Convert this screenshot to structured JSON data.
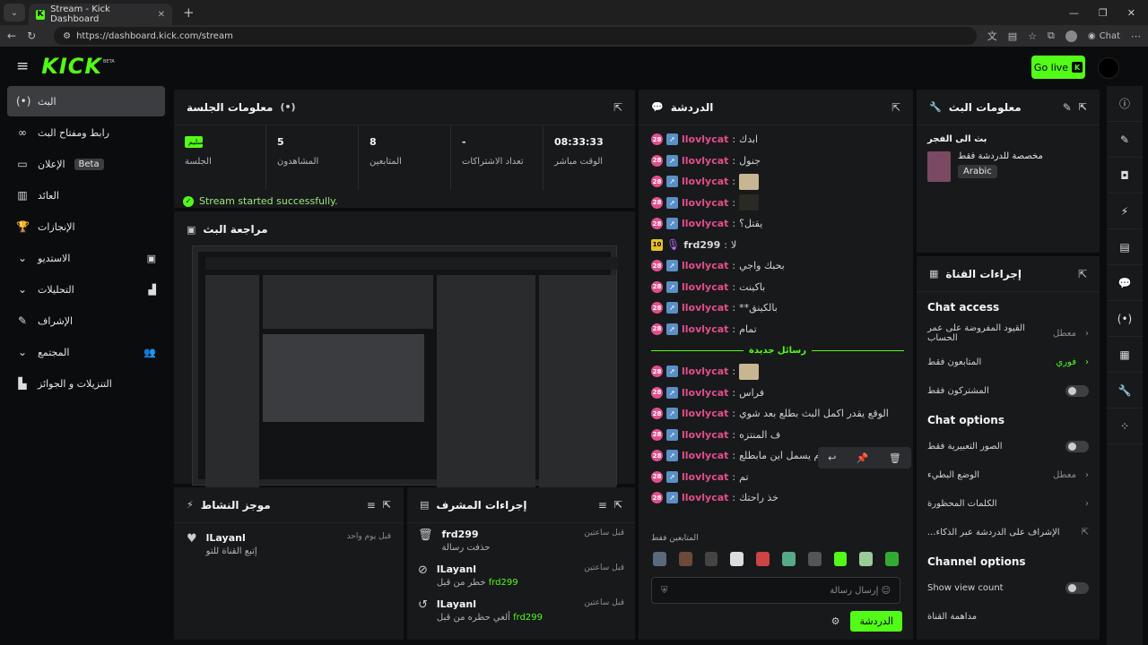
{
  "browser": {
    "tab_title": "Stream - Kick Dashboard",
    "url": "https://dashboard.kick.com/stream",
    "chat_label": "Chat"
  },
  "header": {
    "logo": "KICK",
    "beta": "BETA",
    "go_live": "Go live"
  },
  "sidebar": {
    "items": [
      {
        "label": "البث",
        "icon": "broadcast-icon"
      },
      {
        "label": "رابط ومفتاح البث",
        "icon": "link-icon"
      },
      {
        "label": "الإعلان",
        "badge": "Beta",
        "icon": "ads-icon"
      },
      {
        "label": "العائد",
        "icon": "revenue-icon"
      },
      {
        "label": "الإنجازات",
        "icon": "trophy-icon"
      },
      {
        "label": "الاستديو",
        "icon": "studio-icon"
      },
      {
        "label": "التحليلات",
        "icon": "analytics-icon"
      },
      {
        "label": "الإشراف",
        "icon": "moderation-icon"
      },
      {
        "label": "المجتمع",
        "icon": "community-icon"
      },
      {
        "label": "التنزيلات و الجوائز",
        "icon": "drops-icon"
      }
    ]
  },
  "session": {
    "title": "معلومات الجلسة",
    "health": "سليم",
    "health_label": "الجلسة",
    "viewers": "5",
    "viewers_label": "المشاهدون",
    "followers": "8",
    "followers_label": "المتابعين",
    "subs": "-",
    "subs_label": "تعداد الاشتراكات",
    "uptime": "08:33:33",
    "uptime_label": "الوقت مباشر",
    "success": "Stream started successfully."
  },
  "preview": {
    "title": "مراجعة البث"
  },
  "activity": {
    "title": "موجز النشاط",
    "items": [
      {
        "name": "lLayanl",
        "sub": "إتبع القناة للتو",
        "time": "قبل يوم واحد"
      }
    ]
  },
  "modactions": {
    "title": "إجراءات المشرف",
    "items": [
      {
        "name": "frd299",
        "sub": "حذفت رسالة",
        "time": "قبل ساعتين"
      },
      {
        "name": "lLayanl",
        "sub": "خطر من قبل",
        "who": "frd299",
        "time": "قبل ساعتين"
      },
      {
        "name": "lLayanl",
        "sub": "ألغي حظره من قبل",
        "who": "frd299",
        "time": "قبل ساعتين"
      }
    ]
  },
  "chat": {
    "title": "الدردشة",
    "messages": [
      {
        "user": "llovlycat",
        "text": "ابدك"
      },
      {
        "user": "llovlycat",
        "text": "جنول"
      },
      {
        "user": "llovlycat",
        "text": "",
        "emote": true
      },
      {
        "user": "llovlycat",
        "text": "",
        "emote": true,
        "dark": true
      },
      {
        "user": "llovlycat",
        "text": "يقتل؟"
      },
      {
        "user": "frd299",
        "text": "لا",
        "mod": true
      },
      {
        "user": "llovlycat",
        "text": "بحبك واجي"
      },
      {
        "user": "llovlycat",
        "text": "باكينت"
      },
      {
        "user": "llovlycat",
        "text": "**بالكينق"
      },
      {
        "user": "llovlycat",
        "text": "تمام"
      }
    ],
    "new_label": "رسائل جديدة",
    "new_messages": [
      {
        "user": "llovlycat",
        "text": "",
        "emote": true
      },
      {
        "user": "llovlycat",
        "text": "فراس"
      },
      {
        "user": "llovlycat",
        "text": "الوقع يقدر اكمل البث بطلع بعد شوي"
      },
      {
        "user": "llovlycat",
        "text": "ف المنتزه"
      },
      {
        "user": "llovlycat",
        "text": "تمام يسمل اين مابطلع"
      },
      {
        "user": "llovlycat",
        "text": "تم"
      },
      {
        "user": "llovlycat",
        "text": "خذ راحتك"
      }
    ],
    "followers_only": "المتابعين فقط",
    "input_placeholder": "إرسال رسالة",
    "send": "الدردشة"
  },
  "streaminfo": {
    "title": "معلومات البث",
    "stream_title": "بث الى الفجر",
    "desc": "مخصصة للدردشة فقط",
    "language": "Arabic"
  },
  "channel": {
    "title": "إجراءات القناة",
    "chat_access": "Chat access",
    "rows": [
      {
        "label": "القيود المفروضة على عمر الحساب",
        "val": "معطل"
      },
      {
        "label": "المتابعون فقط",
        "val": "فوري"
      },
      {
        "label": "المشتركون فقط"
      }
    ],
    "chat_options": "Chat options",
    "rows2": [
      {
        "label": "الصور التعبيرية فقط"
      },
      {
        "label": "الوضع البطيء",
        "val": "معطل"
      },
      {
        "label": "الكلمات المحظورة"
      },
      {
        "label": "...الإشراف على الدردشة عبر الذكاء"
      }
    ],
    "channel_options": "Channel options",
    "show_view_count": "Show view count",
    "last": "مداهمة القناة"
  }
}
